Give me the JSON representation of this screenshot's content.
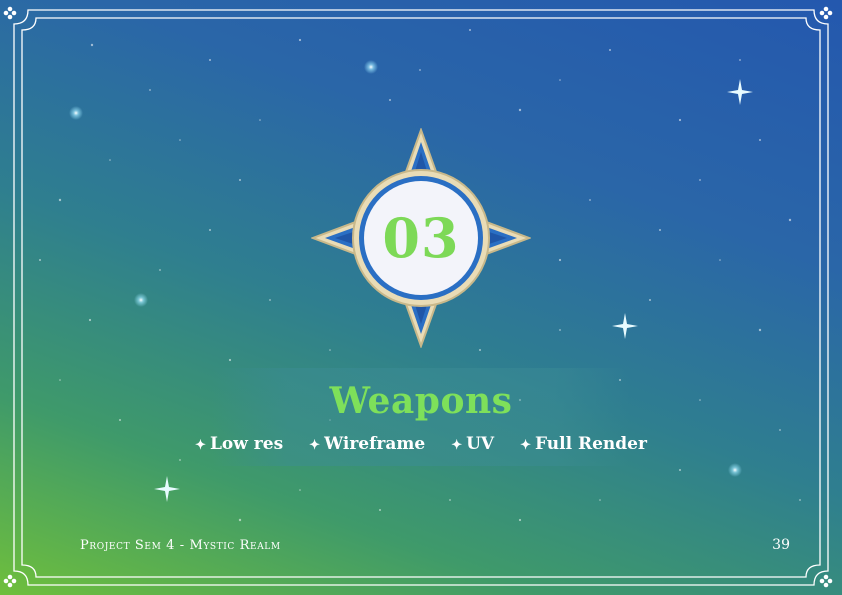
{
  "section": {
    "number": "03",
    "title": "Weapons",
    "subsections": [
      "Low res",
      "Wireframe",
      "UV",
      "Full Render"
    ]
  },
  "footer": {
    "project": "Project Sem 4 - Mystic Realm",
    "page_number": "39"
  },
  "icons": {
    "bullet": "sparkle-bullet-icon",
    "corner": "clover-corner-icon"
  },
  "colors": {
    "accent_green": "#7ee05a",
    "background_top": "#2458ae",
    "background_bottom": "#6fbf3c",
    "frame": "#ffffff",
    "emblem_gold": "#e9dcb6",
    "emblem_blue": "#2a6fc4"
  }
}
